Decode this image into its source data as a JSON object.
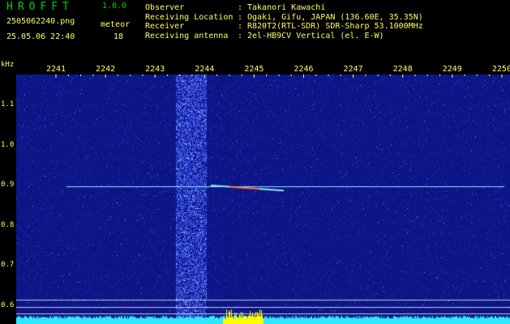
{
  "app": {
    "title": "HROFFT",
    "version": "1.0.0"
  },
  "file": {
    "name": "2505062240.png",
    "datetime": "25.05.06 22:40"
  },
  "meteor": {
    "label": "meteor",
    "count": "18"
  },
  "info": [
    {
      "key": "Observer",
      "sep": ":",
      "value": "Takanori Kawachi"
    },
    {
      "key": "Receiving Location",
      "sep": ":",
      "value": "Ogaki, Gifu, JAPAN (136.60E, 35.35N)"
    },
    {
      "key": "Receiver",
      "sep": ":",
      "value": "R820T2(RTL-SDR) SDR-Sharp 53.1000MHz"
    },
    {
      "key": "Receiving antenna",
      "sep": ":",
      "value": "2el-HB9CV Vertical (el. E-W)"
    }
  ],
  "axis": {
    "freq_unit": "kHz",
    "freq_labels": [
      "2241",
      "2242",
      "2243",
      "2244",
      "2245",
      "2246",
      "2247",
      "2248",
      "2249",
      "2250"
    ],
    "y_labels": [
      "1.1",
      "1.0",
      "0.9",
      "0.8",
      "0.7",
      "0.6"
    ]
  },
  "colors": {
    "text": "#ffff66",
    "title": "#00d000",
    "background": "#0d168a",
    "trace": "#9ef0ff",
    "peak": "#ffff00"
  }
}
